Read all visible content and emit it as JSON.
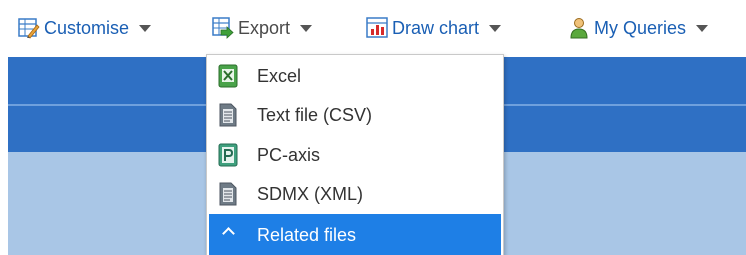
{
  "toolbar": {
    "items": [
      {
        "label": "Customise",
        "icon": "customise-icon"
      },
      {
        "label": "Export",
        "icon": "export-icon"
      },
      {
        "label": "Draw chart",
        "icon": "chart-icon"
      },
      {
        "label": "My Queries",
        "icon": "user-icon"
      }
    ]
  },
  "export_menu": {
    "items": [
      {
        "label": "Excel",
        "icon": "excel-icon"
      },
      {
        "label": "Text file (CSV)",
        "icon": "document-icon"
      },
      {
        "label": "PC-axis",
        "icon": "pc-axis-icon"
      },
      {
        "label": "SDMX (XML)",
        "icon": "document-icon"
      },
      {
        "label": "Related files",
        "icon": "chevron-up-icon"
      }
    ]
  },
  "colors": {
    "link": "#1a5fb4",
    "header_band": "#2f70c4",
    "body_band": "#a9c6e6",
    "selected": "#1e7fe6"
  }
}
